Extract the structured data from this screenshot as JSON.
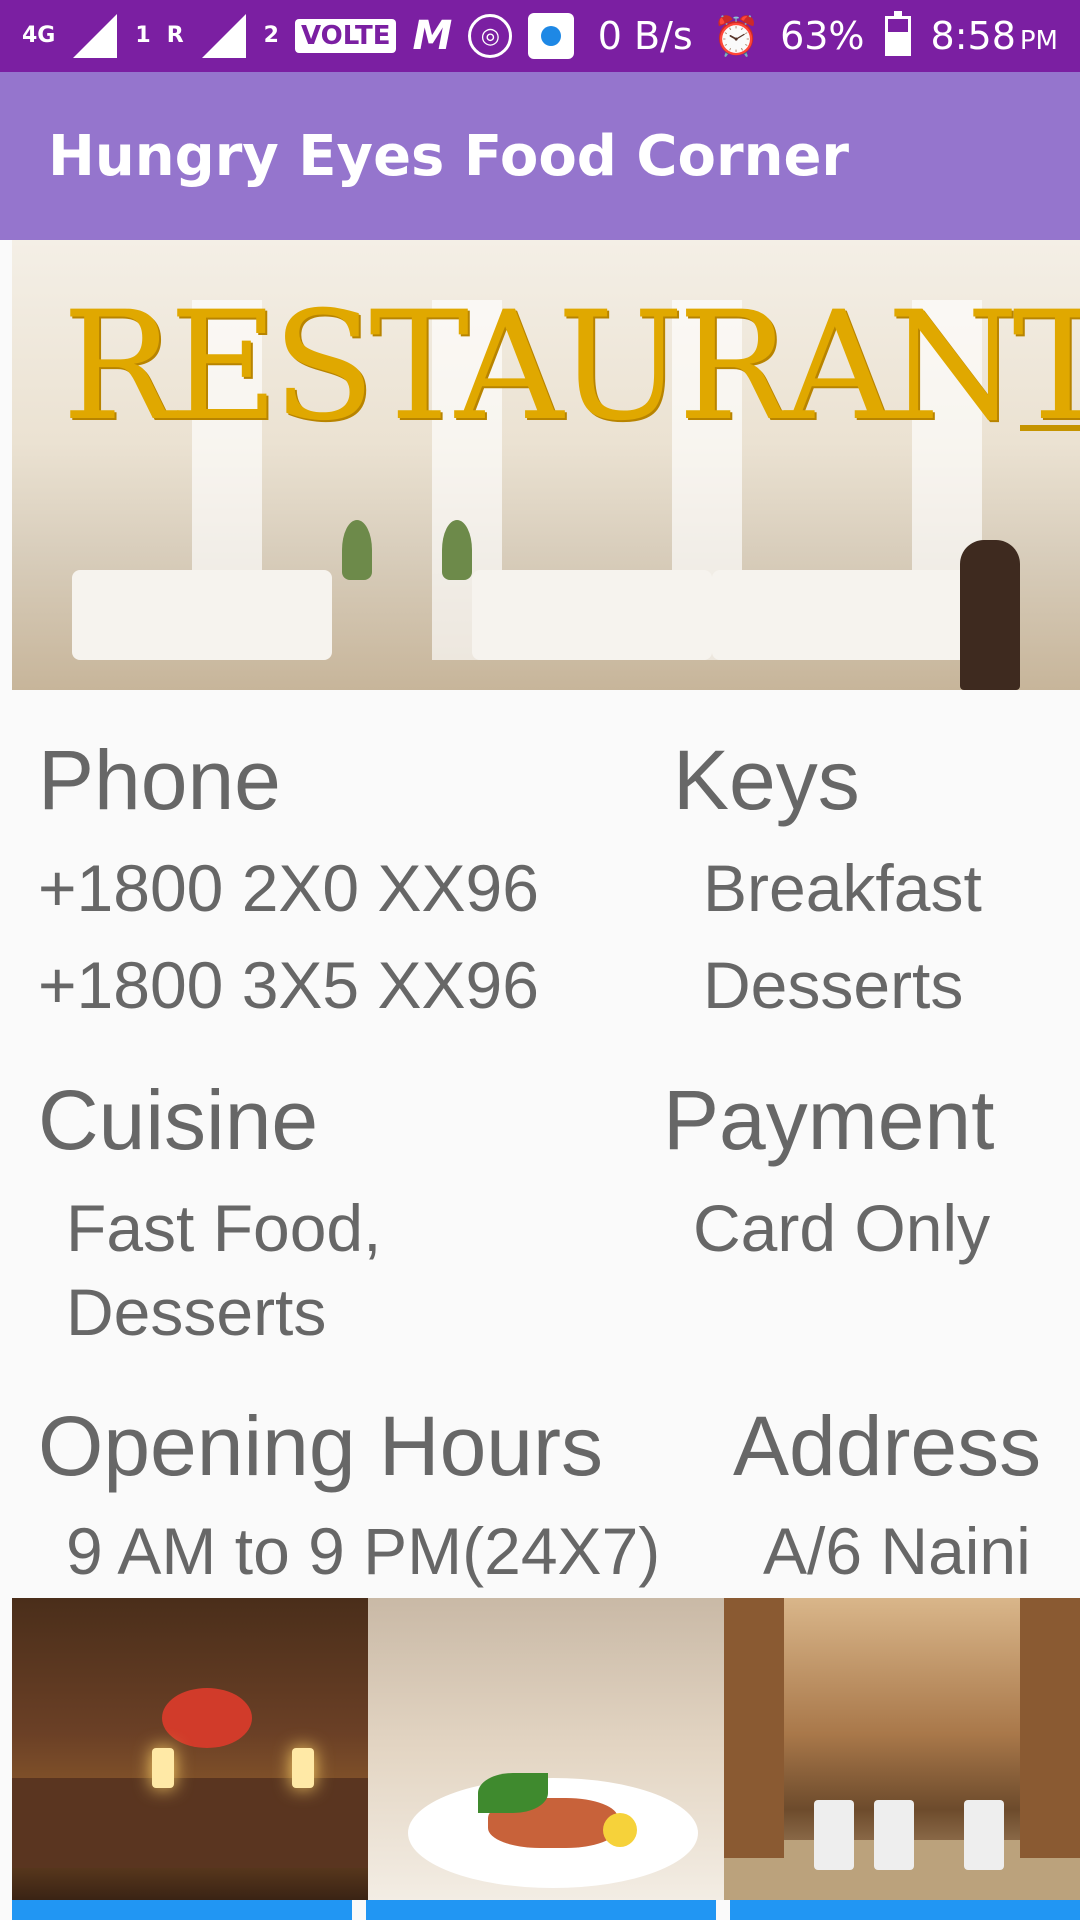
{
  "status_bar": {
    "network": "4G",
    "sim1_index": "1",
    "roaming": "R",
    "sim2_index": "2",
    "volte": "VOLTE",
    "carrier_icon": "M",
    "speed": "0 B/s",
    "battery": "63%",
    "time": "8:58",
    "ampm": "PM",
    "battery_level": 0.63
  },
  "app_bar": {
    "title": "Hungry Eyes Food Corner"
  },
  "hero": {
    "sign_text": "RESTAURANT"
  },
  "info": {
    "phone": {
      "heading": "Phone",
      "values": [
        "+1800 2X0 XX96",
        "+1800 3X5 XX96"
      ]
    },
    "keys": {
      "heading": "Keys",
      "values": [
        "Breakfast",
        "Desserts"
      ]
    },
    "cuisine": {
      "heading": "Cuisine",
      "values": [
        "Fast Food,",
        "Desserts"
      ]
    },
    "payment": {
      "heading": "Payment",
      "values": [
        "Card Only"
      ]
    },
    "hours": {
      "heading": "Opening Hours",
      "value": "9 AM to 9 PM(24X7)"
    },
    "address": {
      "heading": "Address",
      "value": "A/6 Naini"
    }
  },
  "colors": {
    "status_bar": "#7b1fa2",
    "app_bar": "#9575cd",
    "text": "#676767",
    "tab_accent": "#2196f3"
  }
}
